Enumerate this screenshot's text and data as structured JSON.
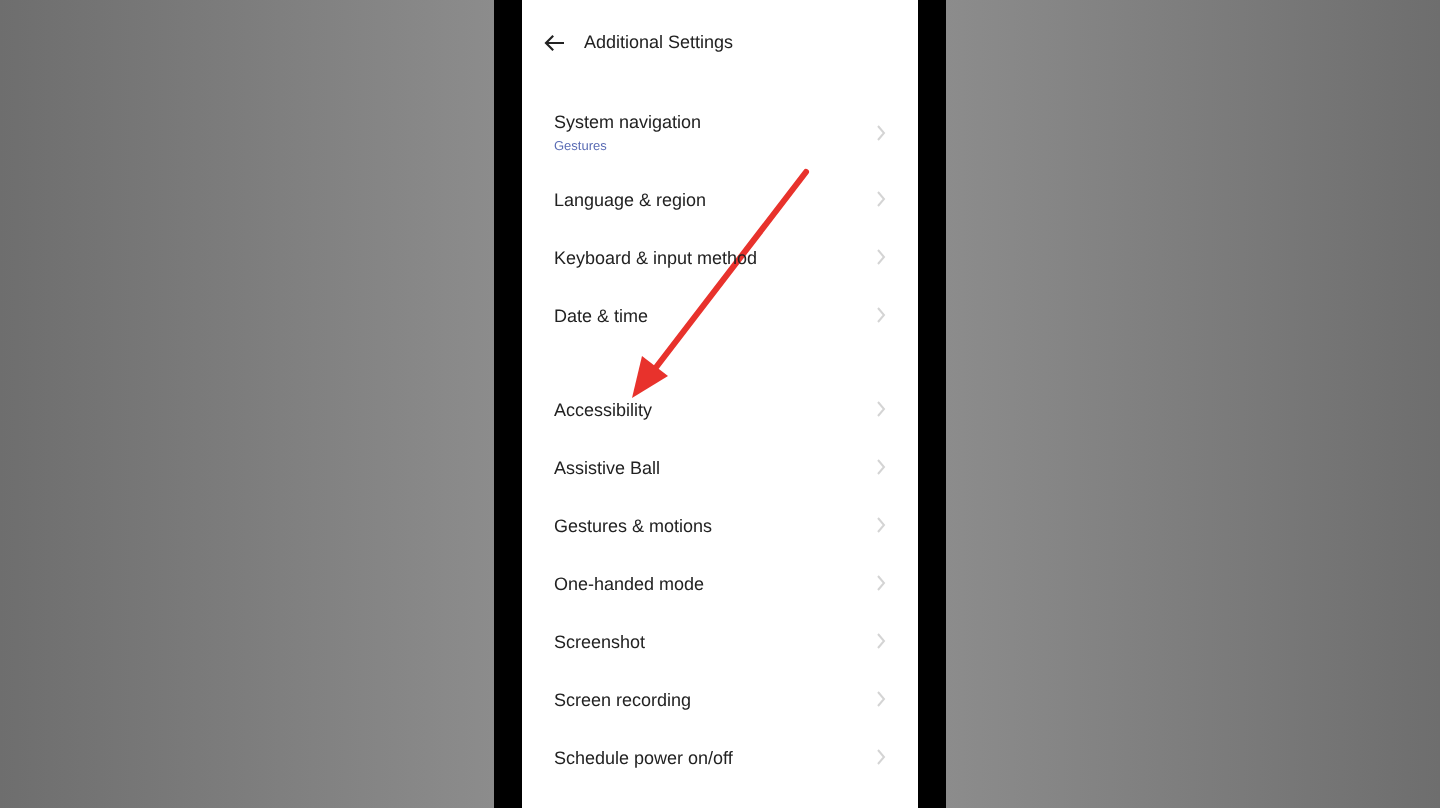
{
  "header": {
    "title": "Additional Settings"
  },
  "groups": [
    {
      "items": [
        {
          "label": "System navigation",
          "subtitle": "Gestures"
        },
        {
          "label": "Language & region"
        },
        {
          "label": "Keyboard & input method"
        },
        {
          "label": "Date & time"
        }
      ]
    },
    {
      "items": [
        {
          "label": "Accessibility"
        },
        {
          "label": "Assistive Ball"
        },
        {
          "label": "Gestures & motions"
        },
        {
          "label": "One-handed mode"
        },
        {
          "label": "Screenshot"
        },
        {
          "label": "Screen recording"
        },
        {
          "label": "Schedule power on/off"
        }
      ]
    }
  ]
}
